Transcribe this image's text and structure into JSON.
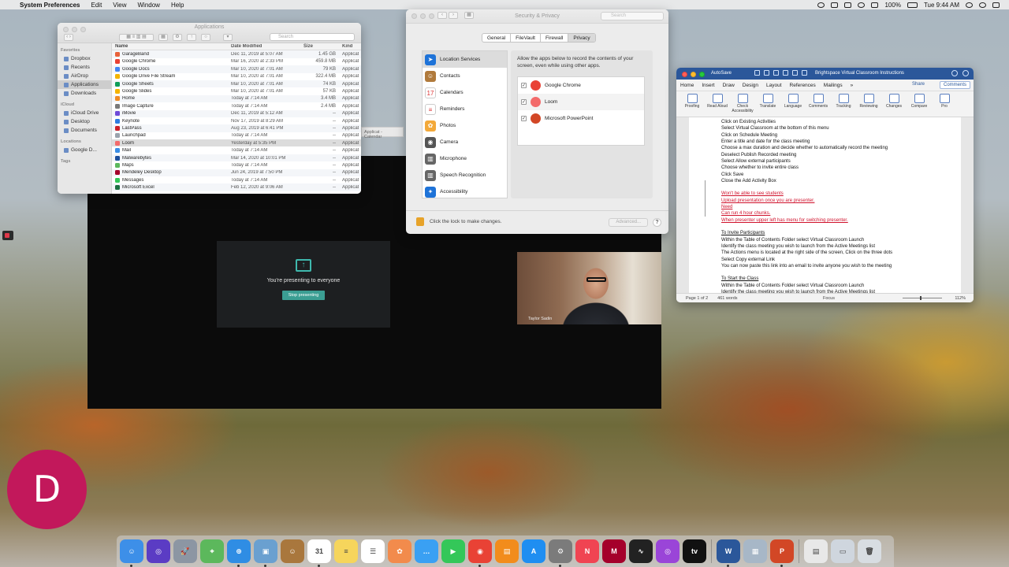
{
  "menubar": {
    "apple": "",
    "app_name": "System Preferences",
    "items": [
      "Edit",
      "View",
      "Window",
      "Help"
    ],
    "battery": "100%",
    "clock": "Tue 9:44 AM"
  },
  "finder": {
    "title": "Applications",
    "search_placeholder": "Search",
    "sidebar": {
      "favorites_label": "Favorites",
      "favorites": [
        "Dropbox",
        "Recents",
        "AirDrop",
        "Applications",
        "Downloads"
      ],
      "icloud_label": "iCloud",
      "icloud": [
        "iCloud Drive",
        "Desktop",
        "Documents"
      ],
      "locations_label": "Locations",
      "locations": [
        "Google D..."
      ],
      "tags_label": "Tags"
    },
    "columns": {
      "name": "Name",
      "date": "Date Modified",
      "size": "Size",
      "kind": "Kind"
    },
    "rows": [
      {
        "name": "GarageBand",
        "date": "Dec 11, 2019 at 5:07 AM",
        "size": "1.45 GB",
        "kind": "Applicati",
        "color": "#e8623b"
      },
      {
        "name": "Google Chrome",
        "date": "Mar 16, 2020 at 2:33 PM",
        "size": "459.8 MB",
        "kind": "Applicati",
        "color": "#e94235"
      },
      {
        "name": "Google Docs",
        "date": "Mar 10, 2020 at 7:01 AM",
        "size": "79 KB",
        "kind": "Applicati",
        "color": "#4285f4"
      },
      {
        "name": "Google Drive File Stream",
        "date": "Mar 10, 2020 at 7:01 AM",
        "size": "322.4 MB",
        "kind": "Applicati",
        "color": "#f4b400"
      },
      {
        "name": "Google Sheets",
        "date": "Mar 10, 2020 at 7:01 AM",
        "size": "74 KB",
        "kind": "Applicati",
        "color": "#0f9d58"
      },
      {
        "name": "Google Slides",
        "date": "Mar 10, 2020 at 7:01 AM",
        "size": "57 KB",
        "kind": "Applicati",
        "color": "#f4b400"
      },
      {
        "name": "Home",
        "date": "Today at 7:14 AM",
        "size": "3.4 MB",
        "kind": "Applicati",
        "color": "#f08a24"
      },
      {
        "name": "Image Capture",
        "date": "Today at 7:14 AM",
        "size": "2.4 MB",
        "kind": "Applicati",
        "color": "#7a7a7a"
      },
      {
        "name": "iMovie",
        "date": "Dec 11, 2019 at 5:12 AM",
        "size": "--",
        "kind": "Applicati",
        "color": "#6f4bd8"
      },
      {
        "name": "Keynote",
        "date": "Nov 17, 2019 at 8:29 AM",
        "size": "--",
        "kind": "Applicati",
        "color": "#2f7de1"
      },
      {
        "name": "LastPass",
        "date": "Aug 23, 2019 at 6:41 PM",
        "size": "--",
        "kind": "Applicati",
        "color": "#cc2029"
      },
      {
        "name": "Launchpad",
        "date": "Today at 7:14 AM",
        "size": "--",
        "kind": "Applicati",
        "color": "#9aa3ad"
      },
      {
        "name": "Loom",
        "date": "Yesterday at 5:35 PM",
        "size": "--",
        "kind": "Applicati",
        "color": "#f36b6b"
      },
      {
        "name": "Mail",
        "date": "Today at 7:14 AM",
        "size": "--",
        "kind": "Applicati",
        "color": "#3a8ee6"
      },
      {
        "name": "Malwarebytes",
        "date": "Mar 14, 2020 at 10:01 PM",
        "size": "--",
        "kind": "Applicati",
        "color": "#1d4f9c"
      },
      {
        "name": "Maps",
        "date": "Today at 7:14 AM",
        "size": "--",
        "kind": "Applicati",
        "color": "#5cb85c"
      },
      {
        "name": "Mendeley Desktop",
        "date": "Jun 24, 2019 at 7:50 PM",
        "size": "--",
        "kind": "Applicati",
        "color": "#a5002b"
      },
      {
        "name": "Messages",
        "date": "Today at 7:14 AM",
        "size": "--",
        "kind": "Applicati",
        "color": "#34c759"
      },
      {
        "name": "Microsoft Excel",
        "date": "Feb 12, 2020 at 9:06 AM",
        "size": "--",
        "kind": "Applicati",
        "color": "#1d6f42"
      }
    ]
  },
  "calendar_tab": {
    "label": "Applicat - Calendar"
  },
  "presenting": {
    "message": "You're presenting to everyone",
    "stop_label": "Stop presenting",
    "webcam_name": "Taylor Sadin"
  },
  "security": {
    "title": "Security & Privacy",
    "search_placeholder": "Search",
    "tabs": [
      "General",
      "FileVault",
      "Firewall",
      "Privacy"
    ],
    "active_tab": "Privacy",
    "categories": [
      {
        "label": "Location Services",
        "color": "#1e73d8",
        "glyph": "➤"
      },
      {
        "label": "Contacts",
        "color": "#b07a3c",
        "glyph": "☺"
      },
      {
        "label": "Calendars",
        "color": "#ffffff",
        "glyph": "17"
      },
      {
        "label": "Reminders",
        "color": "#ffffff",
        "glyph": "≡"
      },
      {
        "label": "Photos",
        "color": "#f3a93a",
        "glyph": "✿"
      },
      {
        "label": "Camera",
        "color": "#555555",
        "glyph": "◉"
      },
      {
        "label": "Microphone",
        "color": "#666666",
        "glyph": "▥"
      },
      {
        "label": "Speech Recognition",
        "color": "#666666",
        "glyph": "▥"
      },
      {
        "label": "Accessibility",
        "color": "#1e73d8",
        "glyph": "✦"
      }
    ],
    "selected_category": "Location Services",
    "description": "Allow the apps below to record the contents of your screen, even while using other apps.",
    "apps": [
      {
        "label": "Google Chrome",
        "checked": "✓",
        "color": "#e94235"
      },
      {
        "label": "Loom",
        "checked": "✓",
        "color": "#f36b6b"
      },
      {
        "label": "Microsoft PowerPoint",
        "checked": "✓",
        "color": "#d24726"
      }
    ],
    "lock_text": "Click the lock to make changes.",
    "advanced_label": "Advanced...",
    "help_label": "?"
  },
  "word": {
    "autosave": "AutoSave",
    "doc_title": "Brightspace Virtual Classroom Instructions",
    "tabs": [
      "Home",
      "Insert",
      "Draw",
      "Design",
      "Layout",
      "References",
      "Mailings"
    ],
    "active_tab": "Review",
    "share_label": "Share",
    "comments_label": "Comments",
    "ribbon": [
      "Proofing",
      "Read Aloud",
      "Check Accessibility",
      "Translate",
      "Language",
      "Comments",
      "Tracking",
      "Reviewing",
      "Changes",
      "Compare",
      "Pro"
    ],
    "lines": [
      {
        "text": "Click on Existing Activities",
        "style": "normal"
      },
      {
        "text": "Select Virtual Classroom at the bottom of this menu",
        "style": "normal"
      },
      {
        "text": "Click on Schedule Meeting",
        "style": "normal"
      },
      {
        "text": "Enter a title and date for the class meeting",
        "style": "normal"
      },
      {
        "text": "Choose a max duration and decide whether to automatically record the meeting",
        "style": "normal"
      },
      {
        "text": "Deselect Publish Recorded meeting",
        "style": "normal"
      },
      {
        "text": "Select Allow external participants",
        "style": "normal"
      },
      {
        "text": "Choose whether to invite entire class",
        "style": "normal"
      },
      {
        "text": "Click Save",
        "style": "normal"
      },
      {
        "text": "Close the Add Activity Box",
        "style": "normal"
      },
      {
        "text": "",
        "style": "gap"
      },
      {
        "text": "Won't be able to see students",
        "style": "red"
      },
      {
        "text": "Upload presentation once you are presenter.",
        "style": "red"
      },
      {
        "text": "Need",
        "style": "red"
      },
      {
        "text": "Can run 4 hour chunks.",
        "style": "red"
      },
      {
        "text": "When presenter upper left has menu for switching presenter.",
        "style": "red"
      },
      {
        "text": "",
        "style": "gap"
      },
      {
        "text": "To Invite Participants",
        "style": "heading"
      },
      {
        "text": "Within the Table of Contents Folder select Virtual Classroom Launch",
        "style": "normal"
      },
      {
        "text": "Identify the class meeting you wish to launch from the Active Meetings list",
        "style": "normal"
      },
      {
        "text": "The Actions menu is located at the right side of the screen, Click on the three dots",
        "style": "normal"
      },
      {
        "text": "Select Copy external Link",
        "style": "normal"
      },
      {
        "text": "You can now paste this link into an email to invite anyone you wish to the meeting",
        "style": "normal"
      },
      {
        "text": "",
        "style": "gap"
      },
      {
        "text": "To Start the Class",
        "style": "heading"
      },
      {
        "text": "Within the Table of Contents Folder select Virtual Classroom Launch",
        "style": "normal"
      },
      {
        "text": "Identify the class meeting you wish to launch from the Active Meetings list",
        "style": "normal"
      }
    ],
    "status": {
      "page": "Page 1 of 2",
      "words": "461 words",
      "focus": "Focus",
      "zoom": "112%"
    }
  },
  "avatar": {
    "initial": "D"
  },
  "dock": [
    {
      "name": "finder",
      "color": "#3d8fe8",
      "glyph": "☺"
    },
    {
      "name": "siri",
      "color": "#5b3cc4",
      "glyph": "◎"
    },
    {
      "name": "launchpad",
      "color": "#8c96a3",
      "glyph": "🚀"
    },
    {
      "name": "maps",
      "color": "#5cb85c",
      "glyph": "⌖"
    },
    {
      "name": "safari",
      "color": "#2f8de4",
      "glyph": "⊕"
    },
    {
      "name": "preview",
      "color": "#6aa0d0",
      "glyph": "▣"
    },
    {
      "name": "contacts",
      "color": "#a9773d",
      "glyph": "☺"
    },
    {
      "name": "calendar",
      "color": "#ffffff",
      "glyph": "31"
    },
    {
      "name": "notes",
      "color": "#f6d55c",
      "glyph": "≡"
    },
    {
      "name": "reminders",
      "color": "#ffffff",
      "glyph": "☰"
    },
    {
      "name": "photos",
      "color": "#f28b4c",
      "glyph": "✿"
    },
    {
      "name": "messages-bubble",
      "color": "#3aa0f3",
      "glyph": "…"
    },
    {
      "name": "facetime",
      "color": "#34c759",
      "glyph": "▶"
    },
    {
      "name": "chrome",
      "color": "#e94235",
      "glyph": "◉"
    },
    {
      "name": "books",
      "color": "#f28c1c",
      "glyph": "▤"
    },
    {
      "name": "app-store",
      "color": "#1f8ef1",
      "glyph": "A"
    },
    {
      "name": "system-preferences",
      "color": "#7b7b7b",
      "glyph": "⚙"
    },
    {
      "name": "news",
      "color": "#f04452",
      "glyph": "N"
    },
    {
      "name": "mendeley",
      "color": "#a5002b",
      "glyph": "M"
    },
    {
      "name": "activity-monitor",
      "color": "#222222",
      "glyph": "∿"
    },
    {
      "name": "podcasts",
      "color": "#9a45d8",
      "glyph": "◎"
    },
    {
      "name": "apple-tv",
      "color": "#111111",
      "glyph": "tv"
    },
    {
      "name": "word",
      "color": "#2b579a",
      "glyph": "W"
    },
    {
      "name": "image-utility",
      "color": "#a7b7c7",
      "glyph": "▦"
    },
    {
      "name": "powerpoint",
      "color": "#d24726",
      "glyph": "P"
    },
    {
      "name": "document-stack",
      "color": "#e8e8e8",
      "glyph": "▤"
    },
    {
      "name": "downloads-stack",
      "color": "#cfd6de",
      "glyph": "▭"
    },
    {
      "name": "trash",
      "color": "#d8dde2",
      "glyph": "🗑"
    }
  ]
}
